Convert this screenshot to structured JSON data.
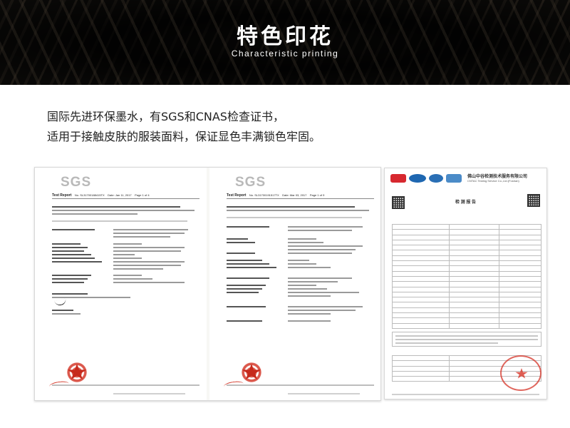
{
  "banner": {
    "title": "特色印花",
    "subtitle": "Characteristic printing"
  },
  "intro": {
    "line1": "国际先进环保墨水，有SGS和CNAS检查证书，",
    "line2": "适用于接触皮肤的服装面料，保证显色丰满锁色牢固。"
  },
  "documents": {
    "sgs_report_1": {
      "logo": "SGS",
      "title": "Test Report",
      "number": "No. SL31700188415TX",
      "date": "Date: Jan 11, 2017",
      "page": "Page 1 of 4"
    },
    "sgs_report_2": {
      "logo": "SGS",
      "title": "Test Report",
      "number": "No. SL31700191517TX",
      "date": "Date: Mar 03, 2017",
      "page": "Page 1 of 9"
    },
    "cma_report": {
      "org_cn": "佛山中谷检测技术服务有限公司",
      "org_en": "CNTAC Testing Service Co.,Ltd.(Foshan)",
      "title": "检 测 报 告"
    }
  }
}
